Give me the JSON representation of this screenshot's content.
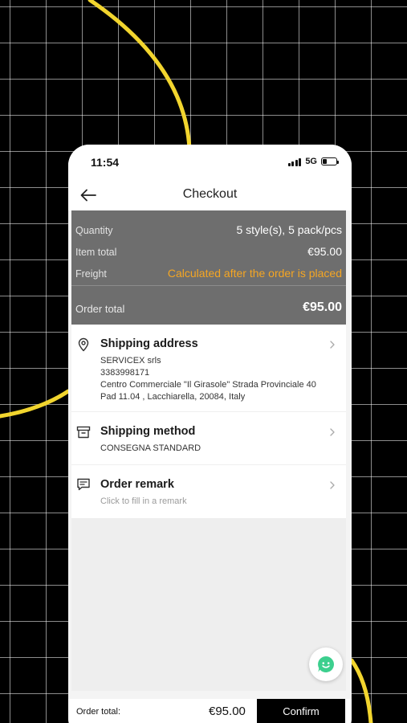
{
  "status_bar": {
    "time": "11:54",
    "network": "5G"
  },
  "nav": {
    "title": "Checkout"
  },
  "summary": {
    "rows": [
      {
        "label": "Quantity",
        "value": "5 style(s), 5 pack/pcs"
      },
      {
        "label": "Item total",
        "value": "€95.00"
      },
      {
        "label": "Freight",
        "value": "Calculated after the order is placed"
      }
    ],
    "order_total_label": "Order total",
    "order_total_value": "€95.00"
  },
  "shipping_address": {
    "title": "Shipping address",
    "lines": [
      "SERVICEX srls",
      "3383998171",
      "Centro Commerciale \"Il Girasole\" Strada Provinciale 40",
      "Pad 11.04 , Lacchiarella, 20084, Italy"
    ]
  },
  "shipping_method": {
    "title": "Shipping method",
    "value": "CONSEGNA STANDARD"
  },
  "order_remark": {
    "title": "Order remark",
    "placeholder": "Click to fill in a remark"
  },
  "bottom": {
    "total_label": "Order total:",
    "total_value": "€95.00",
    "confirm_label": "Confirm"
  },
  "colors": {
    "accent_orange": "#f5a623",
    "summary_bg": "#6e6e6e",
    "deco_yellow": "#f2d52e",
    "help_green": "#3ccf8e"
  },
  "icons": [
    "arrow-left-icon",
    "location-pin-icon",
    "box-icon",
    "message-icon",
    "chevron-right-icon",
    "chat-smile-icon",
    "signal-icon",
    "battery-icon"
  ]
}
